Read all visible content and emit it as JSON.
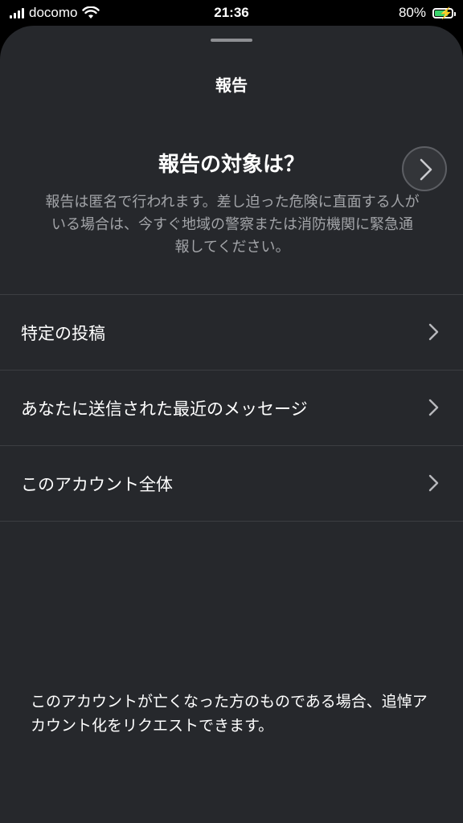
{
  "status_bar": {
    "carrier": "docomo",
    "time": "21:36",
    "battery_percent": "80%",
    "battery_level": 0.8,
    "battery_color": "#3ad36b",
    "icons": [
      "signal-icon",
      "wifi-icon",
      "battery-charging-icon"
    ]
  },
  "sheet": {
    "title": "報告",
    "question": "報告の対象は？",
    "description": "報告は匿名で行われます。差し迫った危険に直面する人がいる場合は、今すぐ地域の警察または消防機関に緊急通報してください。",
    "options": [
      {
        "label": "特定の投稿",
        "icon": "chevron-right-icon"
      },
      {
        "label": "あなたに送信された最近のメッセージ",
        "icon": "chevron-right-icon"
      },
      {
        "label": "このアカウント全体",
        "icon": "chevron-right-icon"
      }
    ],
    "footer": "このアカウントが亡くなった方のものである場合、追悼アカウント化をリクエストできます。"
  },
  "overlay": {
    "icon": "chevron-right-circle-icon"
  },
  "colors": {
    "sheet_background": "#26282c",
    "page_background": "#000000",
    "secondary_text": "#a2a4a8",
    "divider": "#3c3e42"
  }
}
